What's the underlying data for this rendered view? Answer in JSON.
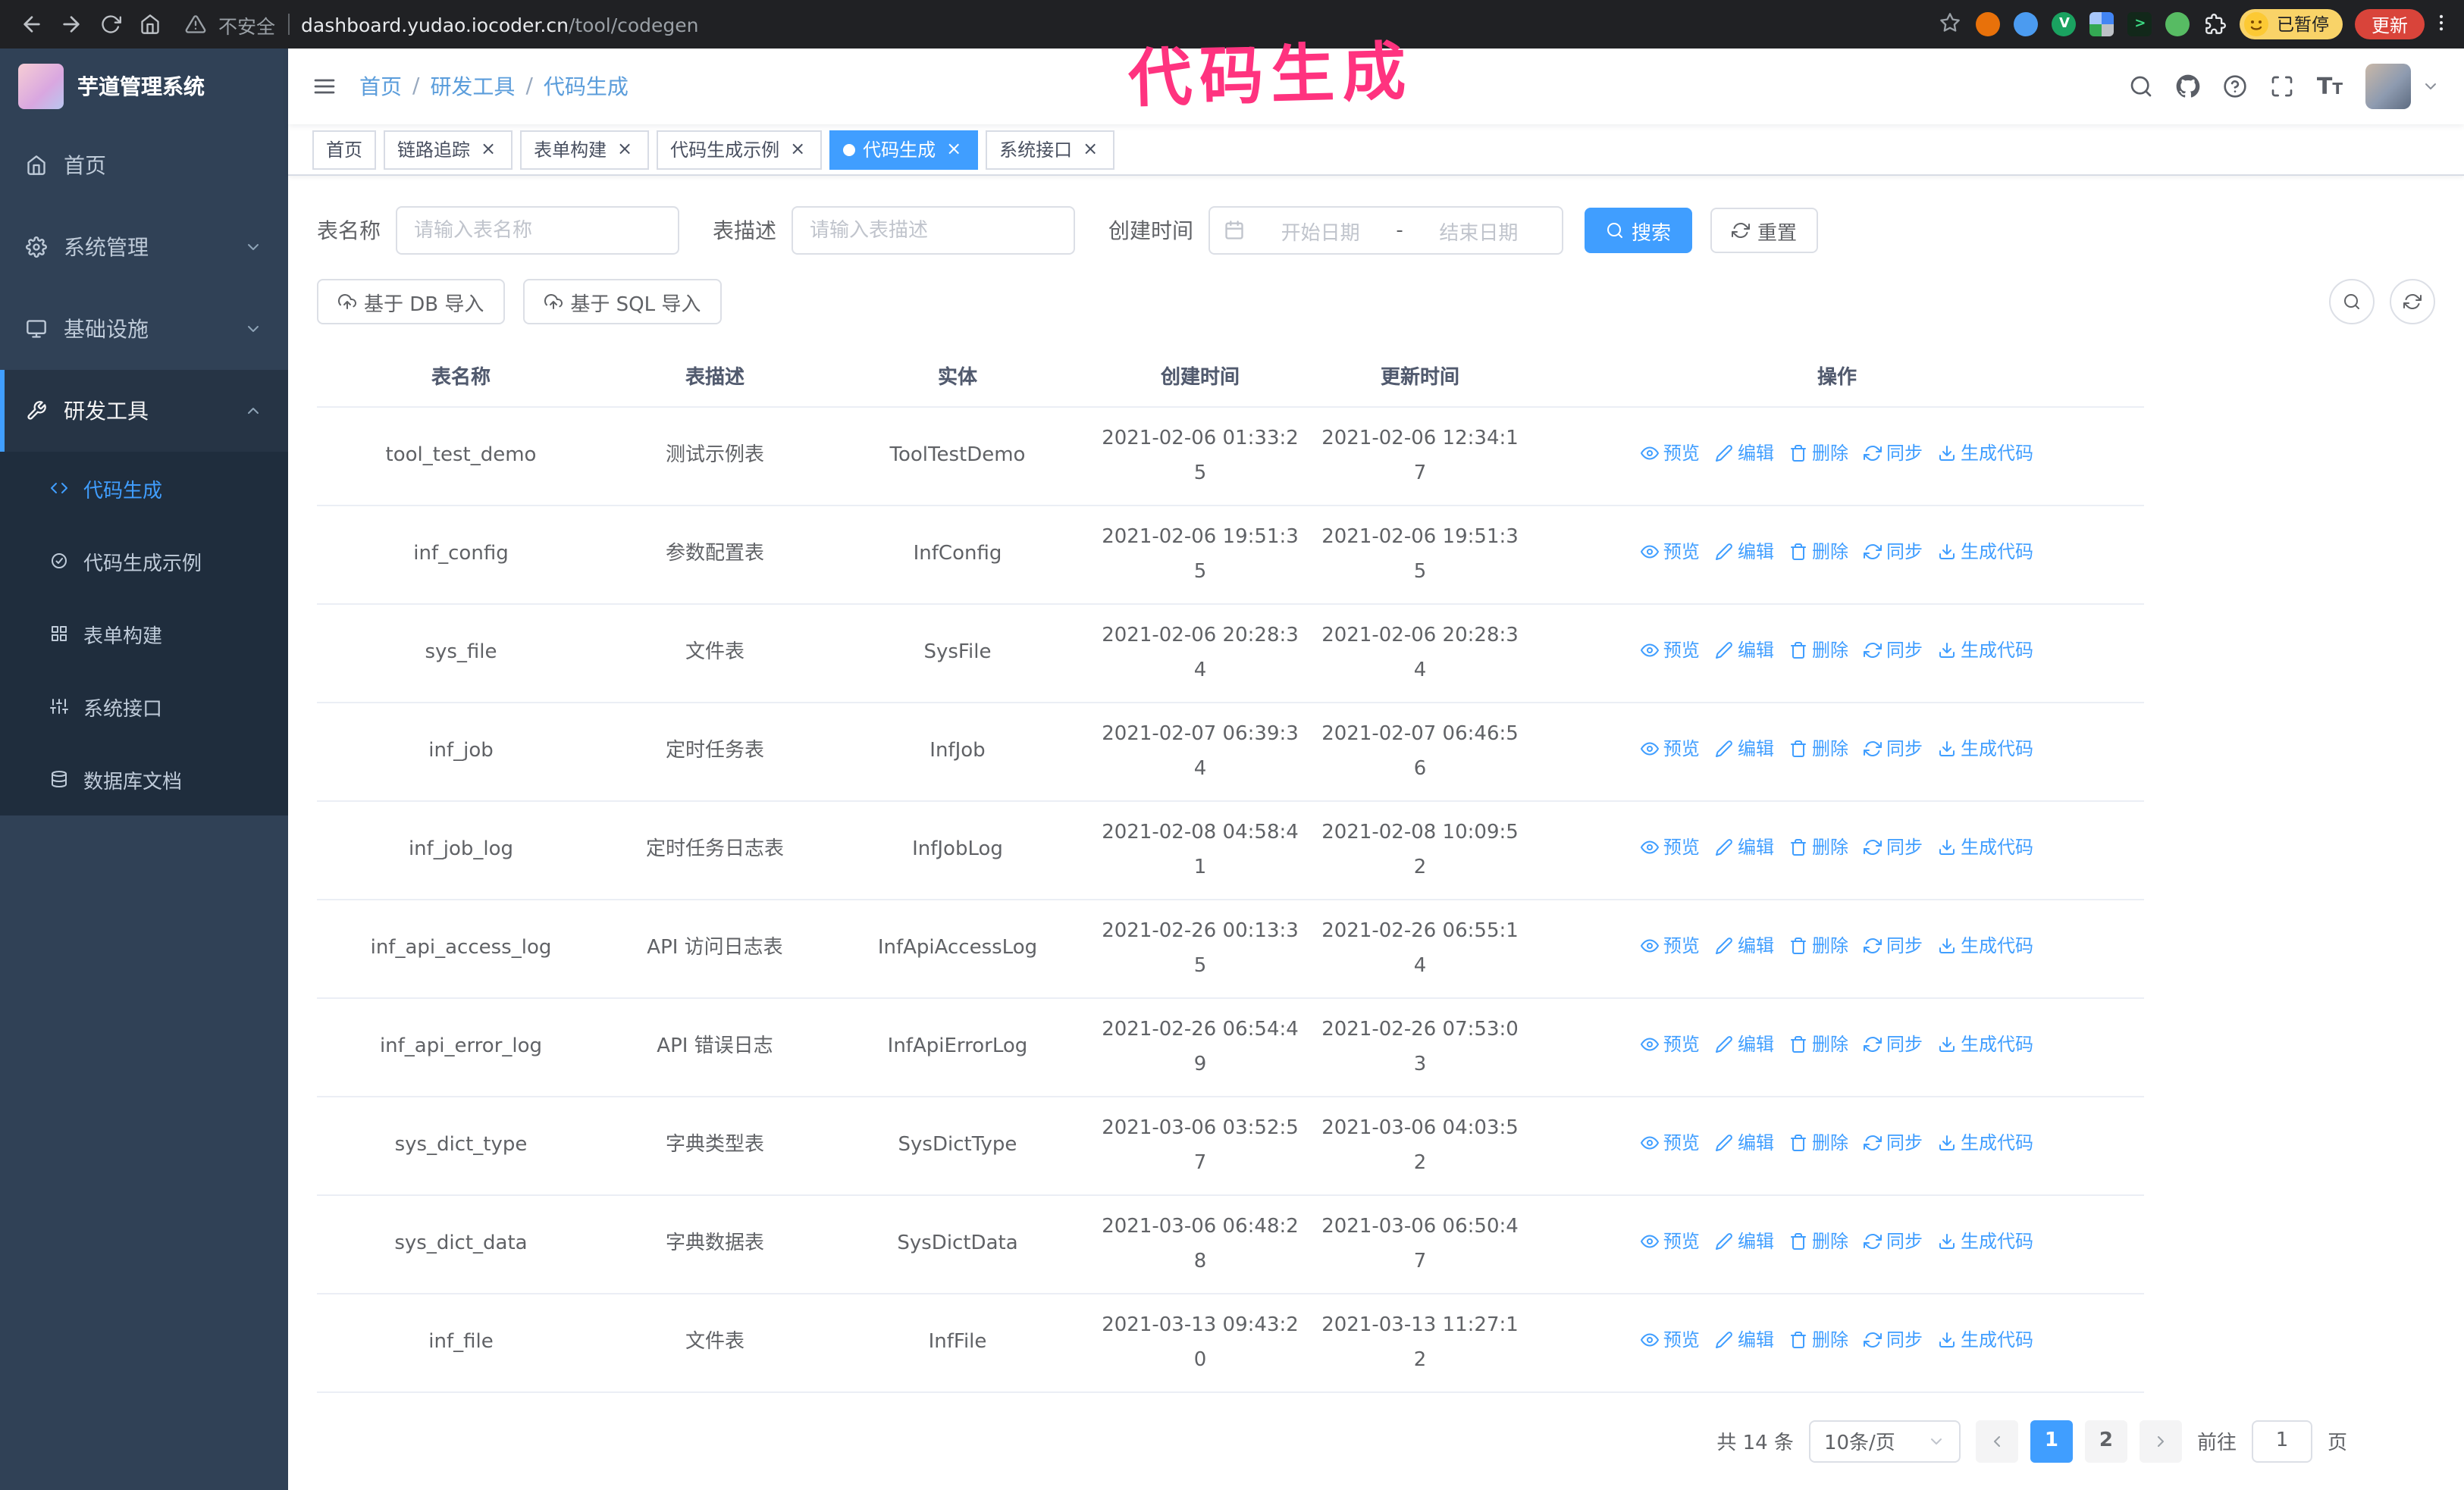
{
  "annotation": {
    "text": "代码生成",
    "color": "#ff337f"
  },
  "browser": {
    "insecure_label": "不安全",
    "url_host": "dashboard.yudao.iocoder.cn",
    "url_path": "/tool/codegen",
    "paused_badge": "已暂停",
    "update_button": "更新"
  },
  "sidebar": {
    "logo_title": "芋道管理系统",
    "items": [
      {
        "label": "首页"
      },
      {
        "label": "系统管理"
      },
      {
        "label": "基础设施"
      },
      {
        "label": "研发工具",
        "children": [
          {
            "label": "代码生成",
            "active": true
          },
          {
            "label": "代码生成示例"
          },
          {
            "label": "表单构建"
          },
          {
            "label": "系统接口"
          },
          {
            "label": "数据库文档"
          }
        ]
      }
    ]
  },
  "header": {
    "breadcrumb": [
      "首页",
      "研发工具",
      "代码生成"
    ],
    "separator": "/"
  },
  "tabs": [
    {
      "label": "首页",
      "closable": false,
      "active": false
    },
    {
      "label": "链路追踪",
      "closable": true,
      "active": false
    },
    {
      "label": "表单构建",
      "closable": true,
      "active": false
    },
    {
      "label": "代码生成示例",
      "closable": true,
      "active": false
    },
    {
      "label": "代码生成",
      "closable": true,
      "active": true
    },
    {
      "label": "系统接口",
      "closable": true,
      "active": false
    }
  ],
  "filters": {
    "table_name_label": "表名称",
    "table_name_placeholder": "请输入表名称",
    "table_desc_label": "表描述",
    "table_desc_placeholder": "请输入表描述",
    "create_time_label": "创建时间",
    "date_start_placeholder": "开始日期",
    "date_separator": "-",
    "date_end_placeholder": "结束日期",
    "search_button": "搜索",
    "reset_button": "重置"
  },
  "toolbar": {
    "import_db": "基于 DB 导入",
    "import_sql": "基于 SQL 导入"
  },
  "table": {
    "columns": [
      "表名称",
      "表描述",
      "实体",
      "创建时间",
      "更新时间",
      "操作"
    ],
    "actions": [
      "预览",
      "编辑",
      "删除",
      "同步",
      "生成代码"
    ],
    "rows": [
      {
        "name": "tool_test_demo",
        "desc": "测试示例表",
        "entity": "ToolTestDemo",
        "created": "2021-02-06 01:33:25",
        "updated": "2021-02-06 12:34:17"
      },
      {
        "name": "inf_config",
        "desc": "参数配置表",
        "entity": "InfConfig",
        "created": "2021-02-06 19:51:35",
        "updated": "2021-02-06 19:51:35"
      },
      {
        "name": "sys_file",
        "desc": "文件表",
        "entity": "SysFile",
        "created": "2021-02-06 20:28:34",
        "updated": "2021-02-06 20:28:34"
      },
      {
        "name": "inf_job",
        "desc": "定时任务表",
        "entity": "InfJob",
        "created": "2021-02-07 06:39:34",
        "updated": "2021-02-07 06:46:56"
      },
      {
        "name": "inf_job_log",
        "desc": "定时任务日志表",
        "entity": "InfJobLog",
        "created": "2021-02-08 04:58:41",
        "updated": "2021-02-08 10:09:52"
      },
      {
        "name": "inf_api_access_log",
        "desc": "API 访问日志表",
        "entity": "InfApiAccessLog",
        "created": "2021-02-26 00:13:35",
        "updated": "2021-02-26 06:55:14"
      },
      {
        "name": "inf_api_error_log",
        "desc": "API 错误日志",
        "entity": "InfApiErrorLog",
        "created": "2021-02-26 06:54:49",
        "updated": "2021-02-26 07:53:03"
      },
      {
        "name": "sys_dict_type",
        "desc": "字典类型表",
        "entity": "SysDictType",
        "created": "2021-03-06 03:52:57",
        "updated": "2021-03-06 04:03:52"
      },
      {
        "name": "sys_dict_data",
        "desc": "字典数据表",
        "entity": "SysDictData",
        "created": "2021-03-06 06:48:28",
        "updated": "2021-03-06 06:50:47"
      },
      {
        "name": "inf_file",
        "desc": "文件表",
        "entity": "InfFile",
        "created": "2021-03-13 09:43:20",
        "updated": "2021-03-13 11:27:12"
      }
    ]
  },
  "pagination": {
    "total": "共 14 条",
    "page_size": "10条/页",
    "pages": [
      {
        "label": "1",
        "active": true
      },
      {
        "label": "2",
        "active": false
      }
    ],
    "goto_label": "前往",
    "goto_value": "1",
    "goto_suffix": "页"
  },
  "icons": {
    "search": "magnifier",
    "reset": "circular-arrows",
    "calendar": "calendar",
    "import": "cloud-upload",
    "preview": "eye",
    "edit": "pencil",
    "delete": "trash",
    "sync": "sync-arrows",
    "generate": "download"
  }
}
